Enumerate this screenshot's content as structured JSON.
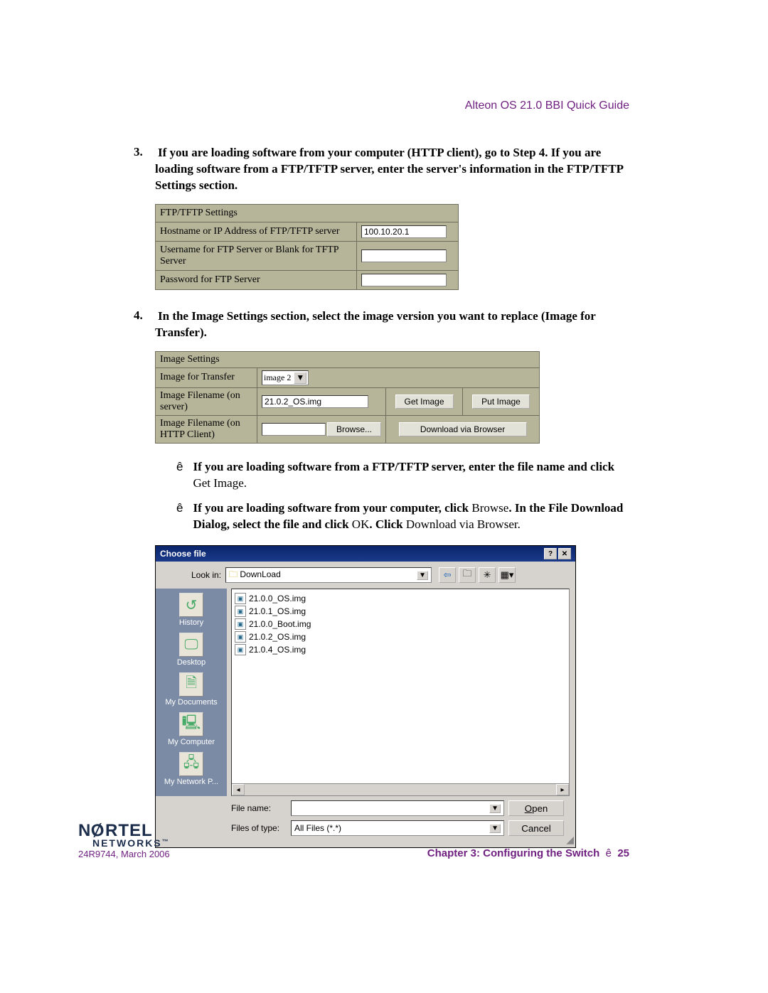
{
  "header": {
    "title": "Alteon OS 21.0 BBI Quick Guide"
  },
  "steps": {
    "s3": {
      "num": "3.",
      "text": "If you are loading software from your computer (HTTP client), go to Step 4. If you are loading software from a FTP/TFTP server, enter the server's information in the FTP/TFTP Settings section."
    },
    "s4": {
      "num": "4.",
      "text": "In the Image Settings section, select the image version you want to replace (Image for Transfer)."
    }
  },
  "ftp_table": {
    "header": "FTP/TFTP Settings",
    "rows": [
      {
        "label": "Hostname or IP Address of FTP/TFTP server",
        "value": "100.10.20.1"
      },
      {
        "label": "Username for FTP Server or Blank for TFTP Server",
        "value": ""
      },
      {
        "label": "Password for FTP Server",
        "value": ""
      }
    ]
  },
  "img_table": {
    "header": "Image Settings",
    "transfer_label": "Image for Transfer",
    "transfer_value": "image 2",
    "fname_server_label": "Image Filename (on server)",
    "fname_server_value": "21.0.2_OS.img",
    "get_btn": "Get Image",
    "put_btn": "Put Image",
    "fname_http_label": "Image Filename (on HTTP Client)",
    "browse_btn": "Browse...",
    "dl_btn": "Download via Browser"
  },
  "bullets": {
    "b1_bold": "If you are loading software from a FTP/TFTP server, enter the file name and click",
    "b1_plain": "Get Image.",
    "b2_a": "If you are loading software from your computer, click ",
    "b2_b": "Browse",
    "b2_c": ". In the File Download Dialog, select the file and click ",
    "b2_d": "OK",
    "b2_e": ". Click ",
    "b2_f": "Download via Browser",
    "b2_g": "."
  },
  "dialog": {
    "title": "Choose file",
    "lookin_label": "Look in:",
    "lookin_value": "DownLoad",
    "places": [
      "History",
      "Desktop",
      "My Documents",
      "My Computer",
      "My Network P..."
    ],
    "files": [
      "21.0.0_OS.img",
      "21.0.1_OS.img",
      "21.0.0_Boot.img",
      "21.0.2_OS.img",
      "21.0.4_OS.img"
    ],
    "filename_label": "File name:",
    "filename_value": "",
    "filetype_label": "Files of type:",
    "filetype_value": "All Files (*.*)",
    "open_btn": "Open",
    "cancel_btn": "Cancel"
  },
  "footer": {
    "logo_top": "NORTEL",
    "logo_bottom": "NETWORKS",
    "docid": "24R9744, March 2006",
    "chapter": "Chapter 3: Configuring the Switch",
    "bullet": "ê",
    "pagenum": "25"
  }
}
